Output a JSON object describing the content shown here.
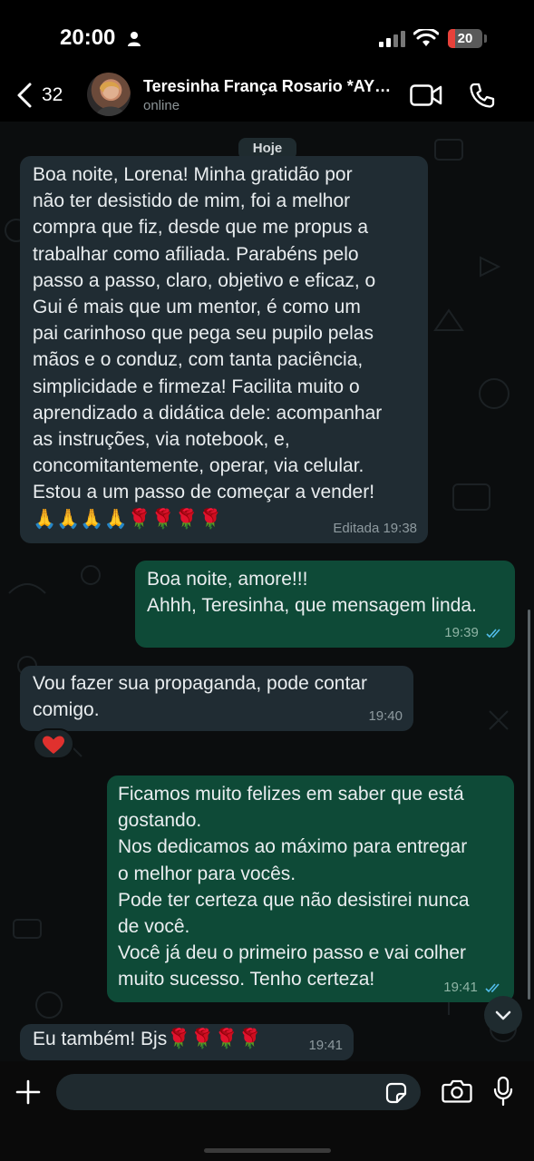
{
  "status_bar": {
    "time": "20:00",
    "battery": "20",
    "battery_level_percent": 20
  },
  "header": {
    "back_count": "32",
    "contact_name": "Teresinha França Rosario *AYLA*",
    "contact_status": "online"
  },
  "chat": {
    "date_label": "Hoje",
    "messages": [
      {
        "direction": "incoming",
        "text": "Boa noite, Lorena! Minha gratidão  por\nnão ter desistido de mim, foi a melhor\ncompra que fiz, desde que me propus a\ntrabalhar como afiliada. Parabéns  pelo\npasso a passo, claro, objetivo e eficaz, o\nGui é  mais que um mentor, é  como um\npai carinhoso que pega seu pupilo pelas\nmãos  e o conduz, com tanta paciência,\nsimplicidade e firmeza! Facilita muito o\naprendizado a didática dele: acompanhar\nas instruções, via notebook, e,\nconcomitantemente,  operar, via celular.\nEstou a um passo de começar a vender!\n🙏🙏🙏🙏🌹🌹🌹🌹",
        "meta": "Editada 19:38"
      },
      {
        "direction": "outgoing",
        "text": "Boa noite, amore!!!\nAhhh, Teresinha, que mensagem linda.",
        "meta": "19:39",
        "read": true
      },
      {
        "direction": "incoming",
        "text": "Vou fazer sua propaganda, pode contar\ncomigo.",
        "meta": "19:40",
        "reaction": "❤️"
      },
      {
        "direction": "outgoing",
        "text": "Ficamos muito felizes em saber que está\ngostando.\nNos dedicamos ao máximo para entregar\no melhor para vocês.\nPode ter certeza que não desistirei nunca\nde você.\nVocê já deu o primeiro passo e vai colher\nmuito sucesso. Tenho certeza!",
        "meta": "19:41",
        "read": true
      },
      {
        "direction": "incoming",
        "text": "Eu também! Bjs🌹🌹🌹🌹",
        "meta": "19:41"
      }
    ]
  },
  "composer": {
    "placeholder": ""
  },
  "icons": {
    "back": "chevron-left-icon",
    "video_call": "video-camera-icon",
    "voice_call": "phone-icon",
    "attach": "plus-icon",
    "sticker": "sticker-icon",
    "camera": "camera-icon",
    "mic": "microphone-icon",
    "scroll_down": "chevron-down-icon"
  },
  "colors": {
    "incoming_bubble": "#202c33",
    "outgoing_bubble": "#0e4a37",
    "read_ticks": "#53bdeb",
    "battery_red": "#e8413a"
  }
}
